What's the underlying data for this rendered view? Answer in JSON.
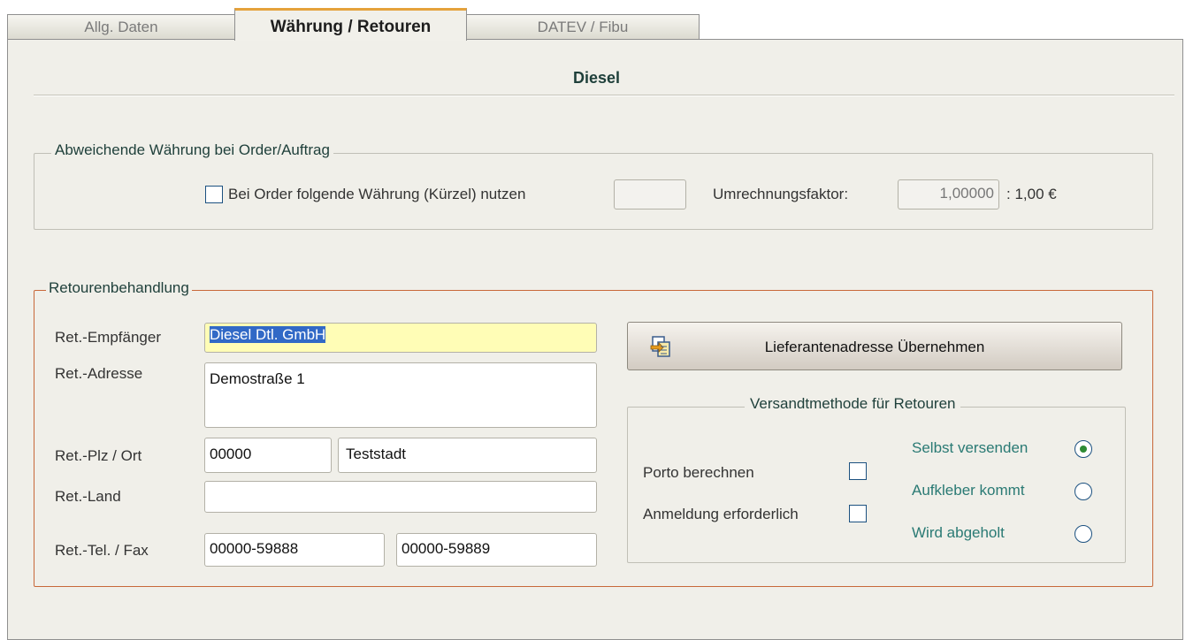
{
  "tabs": [
    {
      "label": "Allg. Daten"
    },
    {
      "label": "Währung / Retouren"
    },
    {
      "label": "DATEV / Fibu"
    }
  ],
  "header": {
    "title": "Diesel"
  },
  "currency": {
    "legend": "Abweichende Währung bei Order/Auftrag",
    "checkbox_label": "Bei Order folgende Währung (Kürzel) nutzen",
    "checked": false,
    "currency_code": "",
    "factor_label": "Umrechnungsfaktor:",
    "factor_value": "1,00000",
    "suffix": ": 1,00 €"
  },
  "returns": {
    "legend": "Retourenbehandlung",
    "recipient_label": "Ret.-Empfänger",
    "recipient_value": "Diesel Dtl. GmbH",
    "address_label": "Ret.-Adresse",
    "address_value": "Demostraße 1",
    "zip_city_label": "Ret.-Plz / Ort",
    "zip_value": "00000",
    "city_value": "Teststadt",
    "country_label": "Ret.-Land",
    "country_value": "",
    "phone_fax_label": "Ret.-Tel. / Fax",
    "phone_value": "00000-59888",
    "fax_value": "00000-59889",
    "copy_button_label": "Lieferantenadresse Übernehmen"
  },
  "shipping": {
    "legend": "Versandtmethode für Retouren",
    "porto_label": "Porto berechnen",
    "porto_checked": false,
    "registration_label": "Anmeldung erforderlich",
    "registration_checked": false,
    "options": [
      {
        "label": "Selbst versenden",
        "selected": true
      },
      {
        "label": "Aufkleber kommt",
        "selected": false
      },
      {
        "label": "Wird abgeholt",
        "selected": false
      }
    ]
  },
  "colors": {
    "accent": "#e5a23c",
    "group_border": "#c8683a",
    "teal_text": "#2a7a74"
  }
}
